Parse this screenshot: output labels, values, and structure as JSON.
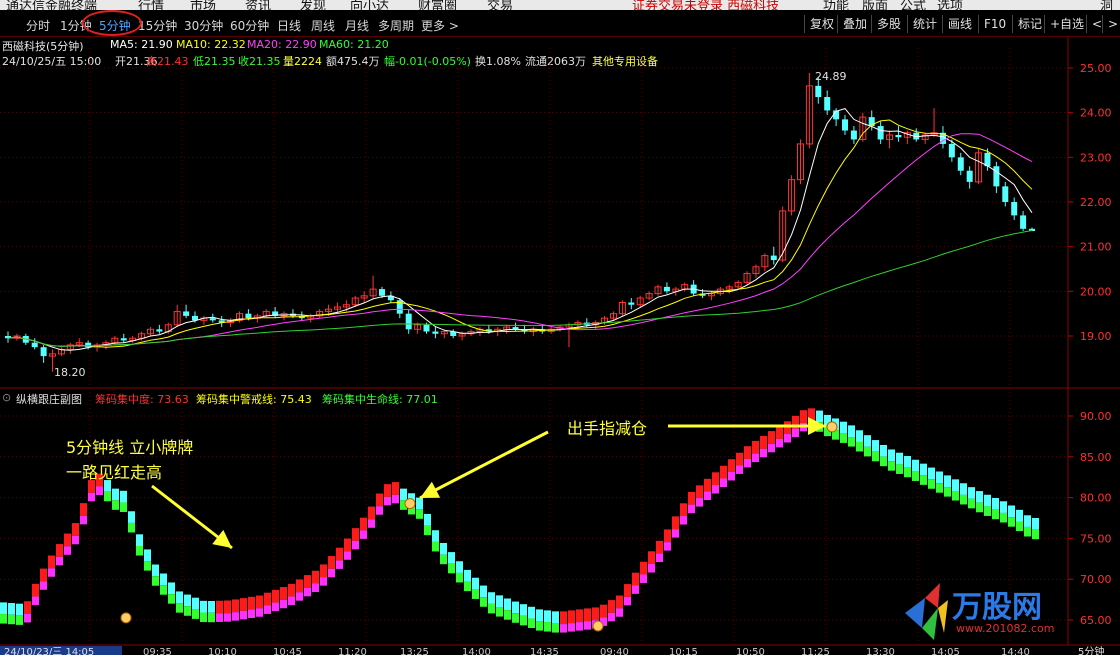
{
  "menu": {
    "items": [
      "通达信金融终端",
      "行情",
      "市场",
      "资讯",
      "发现",
      "向小达",
      "财富圈",
      "交易"
    ],
    "notice": "证券交易未登录 西磁科技",
    "right_items": [
      "功能",
      "版面",
      "公式",
      "选项"
    ],
    "far_right": "洞"
  },
  "toolbar": {
    "periods": [
      "分时",
      "1分钟",
      "5分钟",
      "15分钟",
      "30分钟",
      "60分钟",
      "日线",
      "周线",
      "月线",
      "多周期",
      "更多 >"
    ],
    "active_period": "5分钟",
    "right_buttons": [
      "复权",
      "叠加",
      "多股",
      "统计",
      "画线",
      "F10",
      "标记",
      "+自选",
      "<",
      ">"
    ]
  },
  "main_chart": {
    "title": "西磁科技(5分钟)",
    "ma": [
      {
        "label": "MA5: 21.90",
        "color": "#ffffff"
      },
      {
        "label": "MA10: 22.32",
        "color": "#ffff00"
      },
      {
        "label": "MA20: 22.90",
        "color": "#ff40ff"
      },
      {
        "label": "MA60: 21.20",
        "color": "#30ff30"
      }
    ],
    "info": {
      "date": "24/10/25/五 15:00",
      "open": "开21.36",
      "high": "高21.43",
      "low": "低21.35",
      "close": "收21.35",
      "volume": "量2224",
      "amount": "额475.4万",
      "change": "幅-0.01(-0.05%)",
      "turnover": "换1.08%",
      "float": "流通2063万",
      "sector": "其他专用设备"
    },
    "high_label": "24.89",
    "low_label": "18.20",
    "price_axis": [
      "25.00",
      "24.00",
      "23.00",
      "22.00",
      "21.00",
      "20.00",
      "19.00"
    ]
  },
  "sub_chart": {
    "title": "纵横跟庄副图",
    "lines": [
      {
        "label": "筹码集中度: 73.63",
        "color": "#ff3030"
      },
      {
        "label": "筹码集中警戒线: 75.43",
        "color": "#ffff00"
      },
      {
        "label": "筹码集中生命线: 77.01",
        "color": "#30ff30"
      }
    ],
    "axis": [
      "90.00",
      "85.00",
      "80.00",
      "75.00",
      "70.00",
      "65.00"
    ]
  },
  "annotations": {
    "left_line1": "5分钟线 立小牌牌",
    "left_line2": "一路见红走高",
    "right": "出手指减仓"
  },
  "time_axis": {
    "start": "24/10/23/三 14:05",
    "ticks": [
      "09:35",
      "10:10",
      "10:45",
      "11:20",
      "13:25",
      "14:00",
      "14:35",
      "09:40",
      "10:15",
      "10:50",
      "11:25",
      "13:30",
      "14:05",
      "14:40"
    ],
    "period": "5分钟"
  },
  "watermark": {
    "text": "万股网",
    "url": "www.201082.com"
  },
  "chart_data": {
    "type": "candlestick",
    "title": "西磁科技(5分钟)",
    "ylim": [
      18.0,
      25.3
    ],
    "ohlc_approx": [
      [
        19.0,
        19.1,
        18.85,
        18.95
      ],
      [
        18.95,
        19.05,
        18.9,
        19.0
      ],
      [
        19.0,
        19.05,
        18.8,
        18.85
      ],
      [
        18.85,
        18.95,
        18.7,
        18.75
      ],
      [
        18.75,
        18.8,
        18.4,
        18.55
      ],
      [
        18.55,
        18.7,
        18.2,
        18.6
      ],
      [
        18.6,
        18.75,
        18.55,
        18.7
      ],
      [
        18.7,
        18.85,
        18.6,
        18.8
      ],
      [
        18.8,
        18.95,
        18.75,
        18.85
      ],
      [
        18.85,
        18.9,
        18.7,
        18.75
      ],
      [
        18.75,
        18.85,
        18.65,
        18.8
      ],
      [
        18.8,
        18.9,
        18.7,
        18.85
      ],
      [
        18.85,
        19.0,
        18.8,
        18.95
      ],
      [
        18.95,
        19.05,
        18.85,
        18.9
      ],
      [
        18.9,
        19.0,
        18.85,
        18.95
      ],
      [
        18.95,
        19.1,
        18.9,
        19.05
      ],
      [
        19.05,
        19.2,
        19.0,
        19.15
      ],
      [
        19.15,
        19.25,
        19.05,
        19.1
      ],
      [
        19.1,
        19.3,
        19.05,
        19.25
      ],
      [
        19.25,
        19.7,
        19.2,
        19.55
      ],
      [
        19.55,
        19.7,
        19.4,
        19.45
      ],
      [
        19.45,
        19.55,
        19.3,
        19.35
      ],
      [
        19.35,
        19.45,
        19.25,
        19.4
      ],
      [
        19.4,
        19.5,
        19.3,
        19.35
      ],
      [
        19.35,
        19.45,
        19.2,
        19.3
      ],
      [
        19.3,
        19.4,
        19.2,
        19.35
      ],
      [
        19.35,
        19.55,
        19.3,
        19.5
      ],
      [
        19.5,
        19.6,
        19.35,
        19.4
      ],
      [
        19.4,
        19.5,
        19.3,
        19.45
      ],
      [
        19.45,
        19.6,
        19.4,
        19.55
      ],
      [
        19.55,
        19.65,
        19.4,
        19.45
      ],
      [
        19.45,
        19.55,
        19.35,
        19.5
      ],
      [
        19.5,
        19.6,
        19.4,
        19.45
      ],
      [
        19.45,
        19.55,
        19.35,
        19.4
      ],
      [
        19.4,
        19.5,
        19.3,
        19.45
      ],
      [
        19.45,
        19.6,
        19.4,
        19.55
      ],
      [
        19.55,
        19.7,
        19.45,
        19.6
      ],
      [
        19.6,
        19.75,
        19.5,
        19.65
      ],
      [
        19.65,
        19.8,
        19.55,
        19.7
      ],
      [
        19.7,
        19.9,
        19.65,
        19.85
      ],
      [
        19.85,
        20.0,
        19.75,
        19.9
      ],
      [
        19.9,
        20.35,
        19.85,
        20.05
      ],
      [
        20.05,
        20.1,
        19.85,
        19.9
      ],
      [
        19.9,
        20.0,
        19.75,
        19.8
      ],
      [
        19.8,
        19.85,
        19.4,
        19.5
      ],
      [
        19.5,
        19.6,
        19.05,
        19.15
      ],
      [
        19.15,
        19.3,
        19.05,
        19.25
      ],
      [
        19.25,
        19.3,
        19.05,
        19.1
      ],
      [
        19.1,
        19.2,
        18.95,
        19.05
      ],
      [
        19.05,
        19.15,
        18.95,
        19.1
      ],
      [
        19.1,
        19.15,
        18.95,
        19.0
      ],
      [
        19.0,
        19.1,
        18.9,
        19.05
      ],
      [
        19.05,
        19.15,
        19.0,
        19.1
      ],
      [
        19.1,
        19.2,
        19.0,
        19.15
      ],
      [
        19.15,
        19.25,
        19.05,
        19.1
      ],
      [
        19.1,
        19.2,
        19.0,
        19.15
      ],
      [
        19.15,
        19.25,
        19.05,
        19.2
      ],
      [
        19.2,
        19.3,
        19.1,
        19.15
      ],
      [
        19.15,
        19.25,
        19.05,
        19.1
      ],
      [
        19.1,
        19.2,
        19.0,
        19.15
      ],
      [
        19.15,
        19.25,
        19.05,
        19.1
      ],
      [
        19.1,
        19.2,
        19.05,
        19.15
      ],
      [
        19.15,
        19.25,
        19.1,
        19.2
      ],
      [
        19.2,
        19.3,
        18.75,
        19.25
      ],
      [
        19.25,
        19.35,
        19.15,
        19.3
      ],
      [
        19.3,
        19.4,
        19.2,
        19.25
      ],
      [
        19.25,
        19.35,
        19.15,
        19.3
      ],
      [
        19.3,
        19.45,
        19.25,
        19.4
      ],
      [
        19.4,
        19.55,
        19.35,
        19.5
      ],
      [
        19.5,
        19.8,
        19.45,
        19.75
      ],
      [
        19.75,
        19.85,
        19.6,
        19.7
      ],
      [
        19.7,
        19.9,
        19.65,
        19.85
      ],
      [
        19.85,
        20.0,
        19.8,
        19.95
      ],
      [
        19.95,
        20.15,
        19.9,
        20.1
      ],
      [
        20.1,
        20.2,
        19.95,
        20.0
      ],
      [
        20.0,
        20.1,
        19.9,
        20.05
      ],
      [
        20.05,
        20.2,
        20.0,
        20.15
      ],
      [
        20.15,
        20.25,
        19.9,
        19.95
      ],
      [
        19.95,
        20.05,
        19.85,
        19.9
      ],
      [
        19.9,
        20.0,
        19.8,
        19.95
      ],
      [
        19.95,
        20.1,
        19.9,
        20.05
      ],
      [
        20.05,
        20.15,
        19.95,
        20.1
      ],
      [
        20.1,
        20.25,
        20.05,
        20.2
      ],
      [
        20.2,
        20.45,
        20.15,
        20.4
      ],
      [
        20.4,
        20.6,
        20.3,
        20.55
      ],
      [
        20.55,
        20.85,
        20.45,
        20.8
      ],
      [
        20.8,
        21.0,
        20.6,
        20.7
      ],
      [
        20.7,
        21.9,
        20.65,
        21.8
      ],
      [
        21.8,
        22.6,
        21.7,
        22.5
      ],
      [
        22.5,
        23.4,
        22.4,
        23.3
      ],
      [
        23.3,
        24.89,
        23.2,
        24.6
      ],
      [
        24.6,
        24.8,
        24.2,
        24.35
      ],
      [
        24.35,
        24.5,
        23.95,
        24.05
      ],
      [
        24.05,
        24.1,
        23.7,
        23.85
      ],
      [
        23.85,
        23.95,
        23.5,
        23.6
      ],
      [
        23.6,
        23.7,
        23.3,
        23.4
      ],
      [
        23.4,
        24.0,
        23.35,
        23.9
      ],
      [
        23.9,
        24.05,
        23.6,
        23.7
      ],
      [
        23.7,
        23.8,
        23.3,
        23.4
      ],
      [
        23.4,
        23.6,
        23.2,
        23.5
      ],
      [
        23.5,
        23.7,
        23.35,
        23.45
      ],
      [
        23.45,
        23.6,
        23.3,
        23.55
      ],
      [
        23.55,
        23.65,
        23.35,
        23.4
      ],
      [
        23.4,
        23.55,
        23.3,
        23.5
      ],
      [
        23.5,
        24.1,
        23.45,
        23.55
      ],
      [
        23.55,
        23.7,
        23.2,
        23.3
      ],
      [
        23.3,
        23.4,
        22.9,
        23.0
      ],
      [
        23.0,
        23.1,
        22.6,
        22.7
      ],
      [
        22.7,
        22.8,
        22.3,
        22.45
      ],
      [
        22.45,
        23.2,
        22.4,
        23.1
      ],
      [
        23.1,
        23.2,
        22.7,
        22.8
      ],
      [
        22.8,
        22.9,
        22.2,
        22.35
      ],
      [
        22.35,
        22.45,
        21.9,
        22.0
      ],
      [
        22.0,
        22.1,
        21.6,
        21.7
      ],
      [
        21.7,
        21.8,
        21.35,
        21.4
      ],
      [
        21.4,
        21.43,
        21.35,
        21.35
      ]
    ]
  }
}
